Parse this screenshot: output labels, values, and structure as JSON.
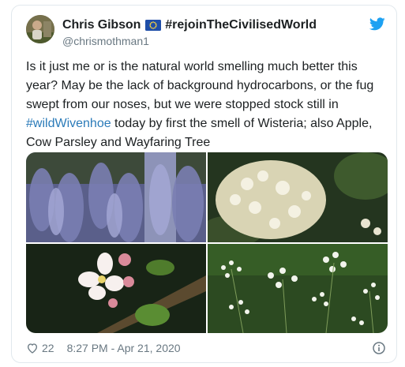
{
  "tweet": {
    "display_name": "Chris Gibson",
    "name_hashtag": "#rejoinTheCivilisedWorld",
    "handle": "@chrismothman1",
    "text_before_tag": "Is it just me or is the natural world smelling much better this year? May be the lack of background hydrocarbons, or the fug swept from our noses, but we were stopped stock still in ",
    "hashtag": "#wildWivenhoe",
    "text_after_tag": " today by first the smell of Wisteria; also Apple, Cow Parsley and Wayfaring Tree",
    "like_count": "22",
    "timestamp": "8:27 PM - Apr 21, 2020"
  },
  "icons": {
    "brand": "twitter-bird-icon",
    "like": "heart-icon",
    "info": "info-icon",
    "flag": "eu-flag-icon"
  },
  "colors": {
    "link": "#2b7bb9",
    "brand": "#1da1f2",
    "muted": "#697882",
    "text": "#1c2022"
  }
}
